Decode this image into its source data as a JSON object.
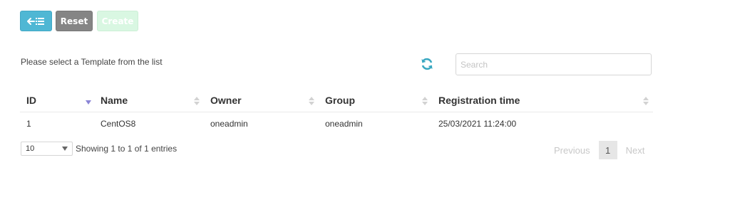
{
  "toolbar": {
    "back_icon": "back-list-icon",
    "reset_label": "Reset",
    "create_label": "Create"
  },
  "hint": "Please select a Template from the list",
  "refresh_icon": "refresh-icon",
  "search": {
    "placeholder": "Search",
    "value": ""
  },
  "table": {
    "columns": [
      "ID",
      "Name",
      "Owner",
      "Group",
      "Registration time"
    ],
    "rows": [
      [
        "1",
        "CentOS8",
        "oneadmin",
        "oneadmin",
        "25/03/2021 11:24:00"
      ]
    ]
  },
  "footer": {
    "page_length": "10",
    "info": "Showing 1 to 1 of 1 entries",
    "previous": "Previous",
    "page": "1",
    "next": "Next"
  },
  "colors": {
    "back_button": "#4fb7d4",
    "reset_button": "#858585",
    "create_button": "#d9f7e2",
    "refresh_icon": "#3aa8c1",
    "sort_active": "#8b86d6"
  }
}
